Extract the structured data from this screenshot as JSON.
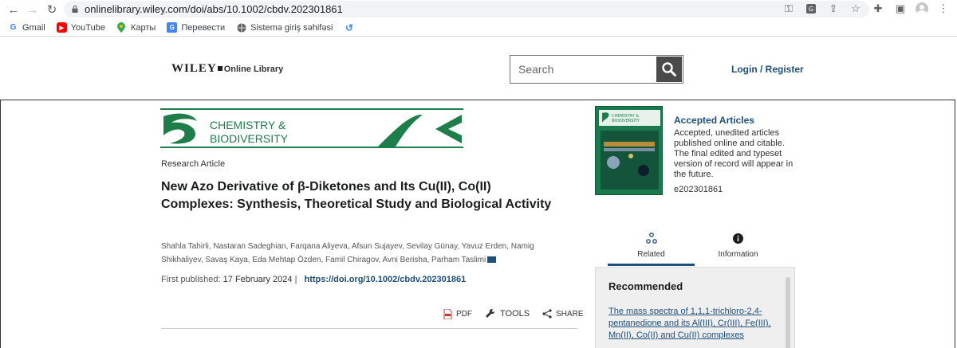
{
  "browser": {
    "url": "onlinelibrary.wiley.com/doi/abs/10.1002/cbdv.202301861",
    "bookmarks": [
      {
        "label": "Gmail",
        "icon": "gmail-icon"
      },
      {
        "label": "YouTube",
        "icon": "youtube-icon"
      },
      {
        "label": "Карты",
        "icon": "maps-icon"
      },
      {
        "label": "Перевести",
        "icon": "translate-icon"
      },
      {
        "label": "Sistemə giriş səhifəsi",
        "icon": "globe-icon"
      }
    ]
  },
  "header": {
    "logo_wiley": "WILEY",
    "logo_online_library": "Online Library",
    "search_placeholder": "Search",
    "login_label": "Login / Register"
  },
  "journal": {
    "name_line1": "CHEMISTRY &",
    "name_line2": "BIODIVERSITY",
    "brand_color": "#1e7e4a"
  },
  "article": {
    "type": "Research Article",
    "title": "New Azo Derivative of β-Diketones and Its Cu(II), Co(II) Complexes:  Synthesis, Theoretical Study and Biological Activity",
    "authors": "Shahla Tahirli, Nastaran Sadeghian, Farqana Aliyeva, Afsun Sujayev, Sevilay Günay, Yavuz Erden, Namig Shikhaliyev, Savaş Kaya, Eda Mehtap Özden, Famil Chiragov, Avni Berisha, Parham Taslimi",
    "first_published_label": "First published:",
    "first_published_date": "17 February 2024",
    "separator": "|",
    "doi": "https://doi.org/10.1002/cbdv.202301861"
  },
  "actions": {
    "pdf": "PDF",
    "tools": "TOOLS",
    "share": "SHARE"
  },
  "rail": {
    "accepted_title": "Accepted Articles",
    "accepted_desc": "Accepted, unedited articles published online and citable. The final edited and typeset version of record will appear in the future.",
    "accepted_id": "e202301861",
    "tabs": [
      {
        "label": "Related",
        "icon": "related-icon"
      },
      {
        "label": "Information",
        "icon": "info-icon"
      }
    ],
    "recommended_heading": "Recommended",
    "recommended_item": "The mass spectra of 1,1,1-trichloro-2,4-pentanedione and its Al(III), Cr(III), Fe(III), Mn(II), Co(II) and Cu(II) complexes"
  },
  "colors": {
    "link": "#1c4f7c",
    "search_button": "#4a4a4a"
  }
}
